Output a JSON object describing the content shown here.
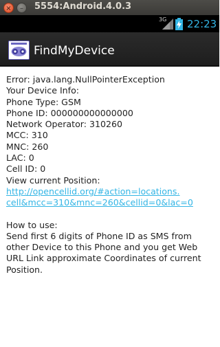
{
  "window": {
    "title": "5554:Android.4.0.3",
    "close_glyph": "×",
    "minimize_glyph": "–"
  },
  "statusbar": {
    "network_label": "3G",
    "time": "22:23",
    "time_color": "#33b5e5"
  },
  "actionbar": {
    "app_title": "FindMyDevice",
    "icon_name": "app-logo-icon"
  },
  "content": {
    "error": "Error: java.lang.NullPointerException",
    "device_info_heading": "Your Device Info:",
    "phone_type": "Phone Type: GSM",
    "phone_id": "Phone ID: 000000000000000",
    "network_operator": "Network Operator: 310260",
    "mcc": "MCC: 310",
    "mnc": "MNC: 260",
    "lac": "LAC: 0",
    "cell_id": "Cell ID: 0",
    "view_position": "View current Position:",
    "link_line1": "http://opencellid.org/#action=locations.",
    "link_line2": "cell&mcc=310&mnc=260&cellid=0&lac=0",
    "how_to_heading": "How to use:",
    "how_to_text": "Send first 6 digits of Phone ID as SMS from other Device to this Phone and you get Web URL Link approximate Coordinates of current Position."
  }
}
